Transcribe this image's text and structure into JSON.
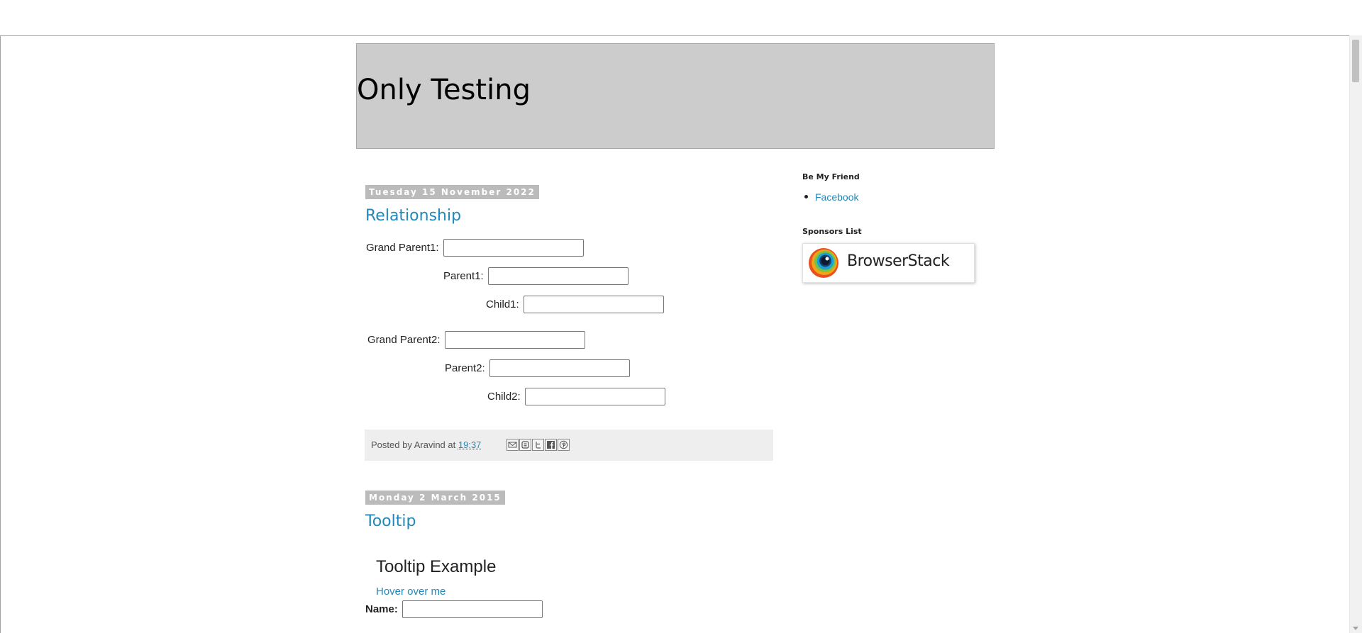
{
  "blog": {
    "title": "Only Testing"
  },
  "posts": [
    {
      "date": "Tuesday 15 November 2022",
      "title": "Relationship",
      "fields": [
        {
          "label": "Grand Parent1:",
          "value": ""
        },
        {
          "label": "Parent1:",
          "value": ""
        },
        {
          "label": "Child1:",
          "value": ""
        },
        {
          "label": "Grand Parent2:",
          "value": ""
        },
        {
          "label": "Parent2:",
          "value": ""
        },
        {
          "label": "Child2:",
          "value": ""
        }
      ],
      "footer": {
        "posted_by": "Posted by Aravind at",
        "time": "19:37"
      },
      "share": [
        "email-icon",
        "blogger-icon",
        "twitter-icon",
        "facebook-icon",
        "pinterest-icon"
      ]
    },
    {
      "date": "Monday 2 March 2015",
      "title": "Tooltip",
      "heading": "Tooltip Example",
      "link": "Hover over me",
      "name_label": "Name:"
    }
  ],
  "sidebar": {
    "widget1": {
      "title": "Be My Friend",
      "link": "Facebook"
    },
    "widget2": {
      "title": "Sponsors List",
      "sponsor": "BrowserStack"
    }
  },
  "colors": {
    "link": "#2288bb",
    "header_bg": "#cccccc",
    "date_badge": "#bbbbbb",
    "footer_bg": "#eeeeee"
  }
}
